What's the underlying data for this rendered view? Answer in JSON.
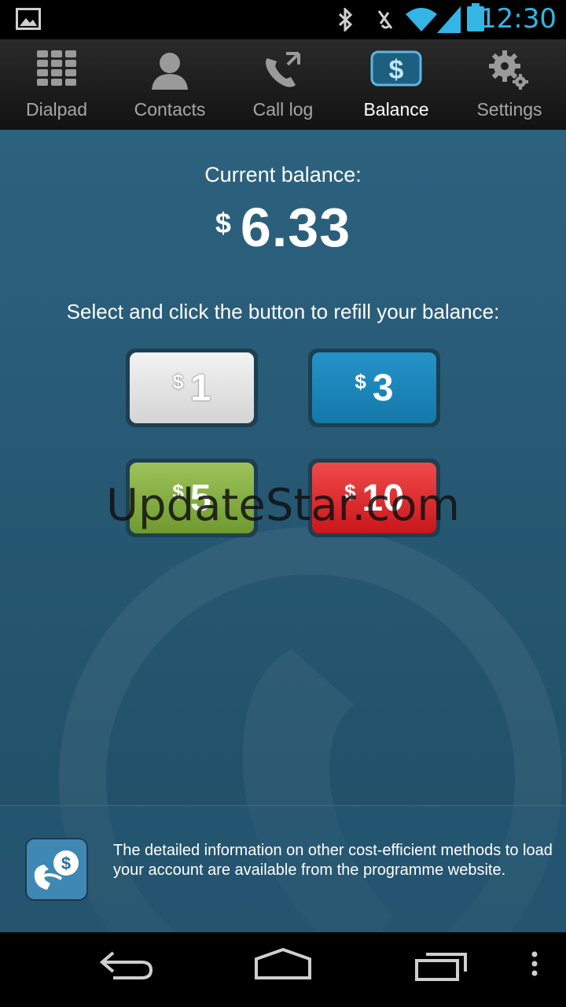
{
  "status_bar": {
    "time": "12:30",
    "accent": "#33b5e5"
  },
  "tabs": [
    {
      "label": "Dialpad",
      "icon": "dialpad-icon",
      "active": false
    },
    {
      "label": "Contacts",
      "icon": "contacts-icon",
      "active": false
    },
    {
      "label": "Call log",
      "icon": "call-log-icon",
      "active": false
    },
    {
      "label": "Balance",
      "icon": "balance-icon",
      "active": true
    },
    {
      "label": "Settings",
      "icon": "settings-icon",
      "active": false
    }
  ],
  "balance": {
    "label": "Current balance:",
    "currency": "$",
    "amount": "6.33"
  },
  "refill": {
    "instruction": "Select and click the button to refill your balance:",
    "buttons": [
      {
        "symbol": "$",
        "value": "1",
        "color": "#e8e8e8"
      },
      {
        "symbol": "$",
        "value": "3",
        "color": "#1c88bd"
      },
      {
        "symbol": "$",
        "value": "5",
        "color": "#88b045"
      },
      {
        "symbol": "$",
        "value": "10",
        "color": "#e0262b"
      }
    ]
  },
  "watermark": "UpdateStar.com",
  "info": {
    "text": "The detailed information on other cost-efficient methods to load your account are available from the programme website."
  }
}
